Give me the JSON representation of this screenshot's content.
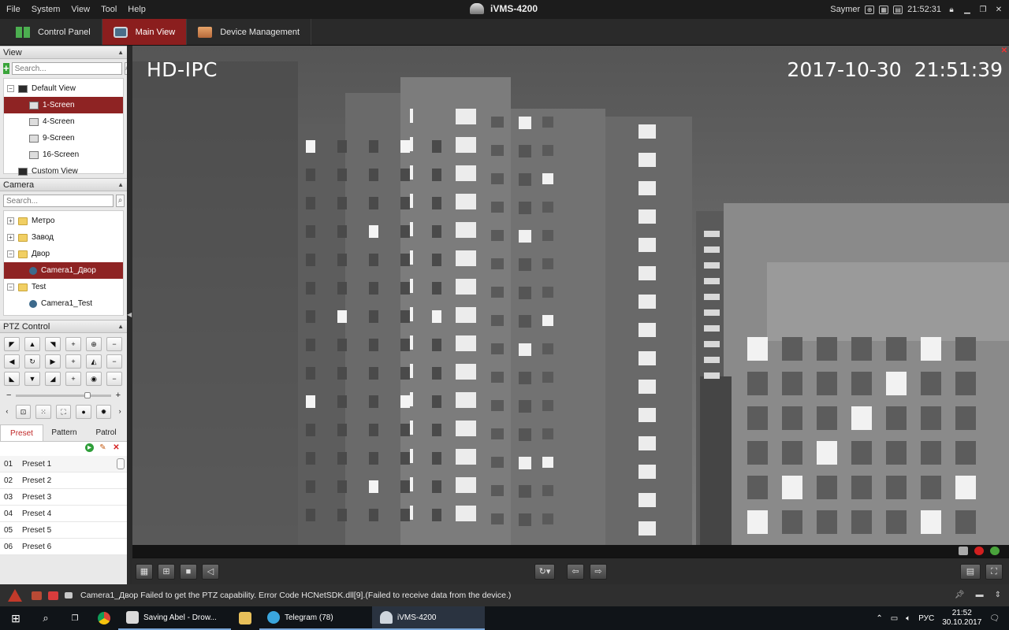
{
  "menubar": {
    "items": [
      "File",
      "System",
      "View",
      "Tool",
      "Help"
    ],
    "app_title": "iVMS-4200",
    "user": "Saymer",
    "time": "21:52:31"
  },
  "tabs": [
    {
      "label": "Control Panel",
      "icon": "control-panel-icon",
      "active": false
    },
    {
      "label": "Main View",
      "icon": "main-view-icon",
      "active": true
    },
    {
      "label": "Device Management",
      "icon": "device-management-icon",
      "active": false
    }
  ],
  "view_panel": {
    "header": "View",
    "search_placeholder": "Search...",
    "tree": [
      {
        "label": "Default View",
        "level": 0,
        "expander": "−",
        "selected": false,
        "icon": "view-icon"
      },
      {
        "label": "1-Screen",
        "level": 1,
        "selected": true,
        "icon": "screen-layout-icon"
      },
      {
        "label": "4-Screen",
        "level": 1,
        "selected": false,
        "icon": "screen-layout-icon"
      },
      {
        "label": "9-Screen",
        "level": 1,
        "selected": false,
        "icon": "screen-layout-icon"
      },
      {
        "label": "16-Screen",
        "level": 1,
        "selected": false,
        "icon": "screen-layout-icon"
      },
      {
        "label": "Custom View",
        "level": 0,
        "selected": false,
        "icon": "view-icon"
      }
    ]
  },
  "camera_panel": {
    "header": "Camera",
    "search_placeholder": "Search...",
    "tree": [
      {
        "label": "Метро",
        "level": 0,
        "expander": "+",
        "icon": "folder-icon",
        "selected": false
      },
      {
        "label": "Завод",
        "level": 0,
        "expander": "+",
        "icon": "folder-icon",
        "selected": false
      },
      {
        "label": "Двор",
        "level": 0,
        "expander": "−",
        "icon": "folder-icon",
        "selected": false
      },
      {
        "label": "Camera1_Двор",
        "level": 1,
        "icon": "camera-icon",
        "selected": true
      },
      {
        "label": "Test",
        "level": 0,
        "expander": "−",
        "icon": "folder-icon",
        "selected": false
      },
      {
        "label": "Camera1_Test",
        "level": 1,
        "icon": "camera-icon",
        "selected": false
      }
    ]
  },
  "ptz": {
    "header": "PTZ Control",
    "grid": [
      "◤",
      "▲",
      "◥",
      "+",
      "⊕",
      "−",
      "◀",
      "↻",
      "▶",
      "+",
      "◭",
      "−",
      "◣",
      "▼",
      "◢",
      "+",
      "◉",
      "−"
    ],
    "grid_names": [
      "pan-up-left-button",
      "pan-up-button",
      "pan-up-right-button",
      "zoom-in-button",
      "zoom-icon",
      "zoom-out-button",
      "pan-left-button",
      "auto-scan-button",
      "pan-right-button",
      "focus-near-button",
      "focus-icon",
      "focus-far-button",
      "pan-down-left-button",
      "pan-down-button",
      "pan-down-right-button",
      "iris-open-button",
      "iris-icon",
      "iris-close-button"
    ],
    "speed_minus": "−",
    "speed_plus": "+",
    "speed_level": 0.75,
    "tools": [
      "‹",
      "⊡",
      "⁙",
      "⛶",
      "●",
      "✹",
      "›"
    ],
    "tabs": [
      "Preset",
      "Pattern",
      "Patrol"
    ],
    "active_tab": "Preset",
    "presets": [
      {
        "num": "01",
        "name": "Preset 1"
      },
      {
        "num": "02",
        "name": "Preset 2"
      },
      {
        "num": "03",
        "name": "Preset 3"
      },
      {
        "num": "04",
        "name": "Preset 4"
      },
      {
        "num": "05",
        "name": "Preset 5"
      },
      {
        "num": "06",
        "name": "Preset 6"
      }
    ]
  },
  "video": {
    "osd_name": "HD-IPC",
    "osd_date": "2017-10-30",
    "osd_time": "21:51:39"
  },
  "alarm": {
    "message": "Camera1_Двор Failed to get the PTZ capability. Error Code HCNetSDK.dll[9].(Failed to receive data from the device.)"
  },
  "taskbar": {
    "apps": [
      {
        "label": "Saving Abel - Drow...",
        "icon": "music-app-icon",
        "color": "#d9d9d9"
      },
      {
        "label": "Telegram (78)",
        "icon": "telegram-icon",
        "color": "#3aa6dd"
      },
      {
        "label": "iVMS-4200",
        "icon": "ivms-icon",
        "color": "#cfd6de"
      }
    ],
    "lang": "РУС",
    "time": "21:52",
    "date": "30.10.2017"
  },
  "colors": {
    "accent": "#8e2323",
    "alert": "#c23a2a"
  }
}
